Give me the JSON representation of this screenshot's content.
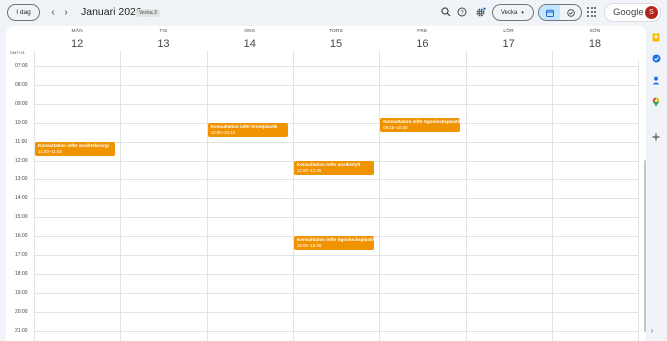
{
  "toolbar": {
    "today_label": "I dag",
    "prev": "‹",
    "next": "›",
    "month_title": "Januari 2026",
    "week_badge": "Vecka 3",
    "view_label": "Vecka",
    "view_caret": "▾"
  },
  "account": {
    "logo": "Google",
    "avatar_letter": "S"
  },
  "timezone": "GMT+01",
  "days": [
    {
      "name": "MÅN",
      "num": "12"
    },
    {
      "name": "TIS",
      "num": "13"
    },
    {
      "name": "ONS",
      "num": "14"
    },
    {
      "name": "TORS",
      "num": "15"
    },
    {
      "name": "FRE",
      "num": "16"
    },
    {
      "name": "LÖR",
      "num": "17"
    },
    {
      "name": "SÖN",
      "num": "18"
    }
  ],
  "hours": [
    "07:00",
    "08:00",
    "09:00",
    "10:00",
    "11:00",
    "12:00",
    "13:00",
    "14:00",
    "15:00",
    "16:00",
    "17:00",
    "18:00",
    "19:00",
    "20:00",
    "21:00"
  ],
  "events": [
    {
      "title": "Konsultation inför ansiktskirurgi",
      "time": "11:00–11:45",
      "day": 0,
      "start": 11.0,
      "color": "#f09300"
    },
    {
      "title": "Konsultation inför bröstplastik",
      "time": "10:00–10:45",
      "day": 2,
      "start": 10.0,
      "color": "#f09300"
    },
    {
      "title": "Konsultation inför ansiktslyft",
      "time": "12:00–12:45",
      "day": 3,
      "start": 12.0,
      "color": "#f09300"
    },
    {
      "title": "Konsultation inför ögonlocksplastik",
      "time": "16:00–16:45",
      "day": 3,
      "start": 16.0,
      "color": "#f09300"
    },
    {
      "title": "Konsultation inför ögonlocksplastik",
      "time": "09:45–10:30",
      "day": 4,
      "start": 9.75,
      "color": "#f09300"
    }
  ],
  "side_icons": [
    "keep-icon",
    "tasks-icon",
    "contacts-icon",
    "maps-icon",
    "add-icon"
  ],
  "colors": {
    "event": "#f09300",
    "view_active": "#c2e7ff",
    "avatar": "#b3261e"
  }
}
